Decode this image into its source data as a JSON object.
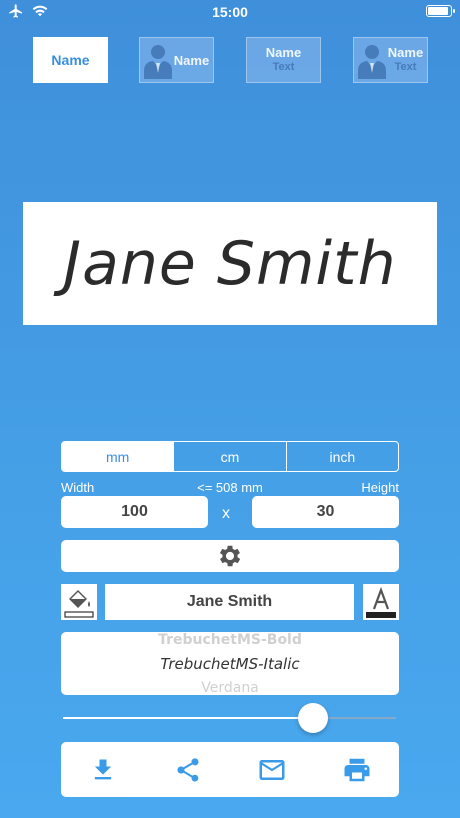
{
  "status_bar": {
    "time": "15:00",
    "airplane": "airplane-icon",
    "wifi": "wifi-icon",
    "battery": "battery-icon"
  },
  "styles": [
    {
      "line1": "Name",
      "line2": "",
      "has_person": false,
      "active": true
    },
    {
      "line1": "Name",
      "line2": "",
      "has_person": true,
      "active": false
    },
    {
      "line1": "Name",
      "line2": "Text",
      "has_person": false,
      "active": false
    },
    {
      "line1": "Name",
      "line2": "Text",
      "has_person": true,
      "active": false
    }
  ],
  "preview": {
    "name": "Jane Smith"
  },
  "units": {
    "options": [
      "mm",
      "cm",
      "inch"
    ],
    "selected": "mm"
  },
  "dimensions": {
    "width_label": "Width",
    "max_hint": "<= 508 mm",
    "height_label": "Height",
    "width_value": "100",
    "height_value": "30",
    "separator": "x"
  },
  "text": {
    "value": "Jane Smith"
  },
  "fonts": {
    "options": [
      "TrebuchetMS-Bold",
      "TrebuchetMS-Italic",
      "Verdana"
    ],
    "selected": "TrebuchetMS-Italic"
  },
  "size_slider": {
    "value": 0.75
  },
  "colors": {
    "accent": "#3a8fe0",
    "icon": "#555555",
    "action_icon": "#3a9be8"
  },
  "actions": [
    "download-icon",
    "share-icon",
    "mail-icon",
    "print-icon"
  ]
}
